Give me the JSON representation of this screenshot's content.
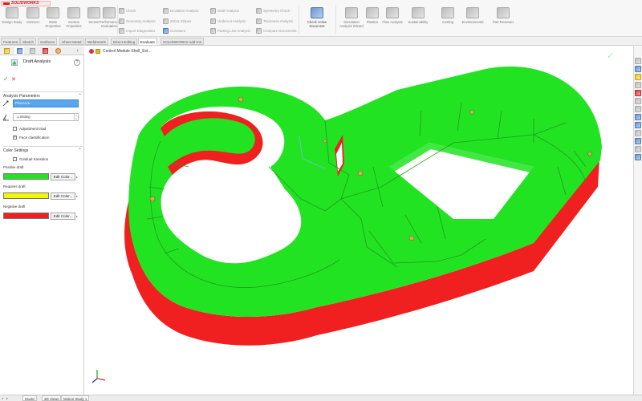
{
  "app": {
    "logo_text": "SOLIDWORKS"
  },
  "ribbon": {
    "big_buttons": [
      {
        "label": "Design Study",
        "icon": "design-study-icon",
        "color": "grey"
      },
      {
        "label": "Reference Compare",
        "icon": "compare-icon",
        "color": "grey"
      },
      {
        "label": "Check Active Document",
        "icon": "check-document-icon",
        "color": "blue"
      },
      {
        "label": "Measure",
        "icon": "measure-icon",
        "color": "grey"
      }
    ],
    "medium_buttons": [
      {
        "label": "Intersect",
        "icon": "intersect-icon",
        "color": "grey"
      },
      {
        "label": "Mass Properties",
        "icon": "mass-properties-icon",
        "color": "grey"
      },
      {
        "label": "Section Properties",
        "icon": "section-properties-icon",
        "color": "grey"
      },
      {
        "label": "Sensor",
        "icon": "sensor-icon",
        "color": "grey"
      },
      {
        "label": "Performance Evaluation",
        "icon": "performance-icon",
        "color": "grey"
      }
    ],
    "small_buttons": [
      {
        "label": "Check",
        "icon": "check-icon",
        "color": "grey"
      },
      {
        "label": "Geometry Analysis",
        "icon": "geometry-analysis-icon",
        "color": "grey"
      },
      {
        "label": "Import Diagnostics",
        "icon": "import-diagnostics-icon",
        "color": "grey"
      },
      {
        "label": "Deviation Analysis",
        "icon": "deviation-icon",
        "color": "grey"
      },
      {
        "label": "Zebra Stripes",
        "icon": "zebra-icon",
        "color": "grey"
      },
      {
        "label": "Curvature",
        "icon": "curvature-icon",
        "color": "blue"
      },
      {
        "label": "Draft Analysis",
        "icon": "draft-analysis-icon",
        "color": "grey"
      },
      {
        "label": "Undercut Analysis",
        "icon": "undercut-icon",
        "color": "grey"
      },
      {
        "label": "Parting Line Analysis",
        "icon": "parting-line-icon",
        "color": "grey"
      },
      {
        "label": "Symmetry Check",
        "icon": "symmetry-icon",
        "color": "grey"
      },
      {
        "label": "Thickness Analysis",
        "icon": "thickness-icon",
        "color": "grey"
      },
      {
        "label": "Compare Documents",
        "icon": "compare-documents-icon",
        "color": "grey"
      }
    ],
    "right_buttons": [
      {
        "label": "Simulation Analysis Wizard",
        "icon": "simulation-icon",
        "color": "grey"
      },
      {
        "label": "Plastics",
        "icon": "plastics-icon",
        "color": "grey"
      },
      {
        "label": "Flow Analysis",
        "icon": "flow-icon",
        "color": "grey"
      },
      {
        "label": "Sustainability",
        "icon": "sustainability-icon",
        "color": "grey"
      },
      {
        "label": "Costing",
        "icon": "costing-icon",
        "color": "grey"
      },
      {
        "label": "Environmental",
        "icon": "environmental-icon",
        "color": "grey"
      },
      {
        "label": "Part Reviewer",
        "icon": "part-reviewer-icon",
        "color": "grey"
      }
    ]
  },
  "command_tabs": [
    {
      "label": "Features",
      "active": false
    },
    {
      "label": "Sketch",
      "active": false
    },
    {
      "label": "Surfaces",
      "active": false
    },
    {
      "label": "Sheet Metal",
      "active": false
    },
    {
      "label": "Weldments",
      "active": false
    },
    {
      "label": "Direct Editing",
      "active": false
    },
    {
      "label": "Evaluate",
      "active": true
    },
    {
      "label": "SOLIDWORKS Add-Ins",
      "active": false
    }
  ],
  "property_manager": {
    "tabs": [
      {
        "icon": "feature-manager-icon",
        "color": "yellow"
      },
      {
        "icon": "property-manager-icon",
        "color": "blue"
      },
      {
        "icon": "configuration-manager-icon",
        "color": "grey"
      },
      {
        "icon": "dimxpert-icon",
        "color": "red"
      },
      {
        "icon": "display-manager-icon",
        "color": "orange"
      }
    ],
    "collapse_glyph": "›",
    "title": "Draft Analysis",
    "help_glyph": "?",
    "ok_glyph": "✓",
    "cancel_glyph": "✕",
    "analysis_parameters": {
      "heading": "Analysis Parameters",
      "chevron": "⌃",
      "face_selection": "Plane1/a",
      "draft_angle": "1.00deg",
      "adjustment_triad_label": "Adjustment triad",
      "adjustment_triad": false,
      "face_classification_label": "Face classification",
      "face_classification": true
    },
    "color_settings": {
      "heading": "Color Settings",
      "chevron": "⌃",
      "gradual_transition_label": "Gradual transition",
      "gradual_transition": false,
      "positive_label": "Positive draft",
      "positive_color": "#22e322",
      "required_label": "Requires draft",
      "required_color": "#f5f505",
      "negative_label": "Negative draft",
      "negative_color": "#f02020",
      "edit_button_label": "Edit Color...",
      "edit_arrow": "▸"
    }
  },
  "graphics": {
    "breadcrumb": "Control Module Shell_Ext...",
    "ok_glyph": "✓",
    "cancel_glyph": "✕",
    "model_colors": {
      "positive": "#22e322",
      "negative": "#f02020",
      "rib_edge": "#1a9e1a",
      "boss_hole": "#c8b54a"
    },
    "triad_axes": [
      "x",
      "y",
      "z"
    ]
  },
  "task_pane": [
    {
      "icon": "resources-icon",
      "color": "grey"
    },
    {
      "icon": "design-library-icon",
      "color": "blue"
    },
    {
      "icon": "file-explorer-icon",
      "color": "yellow"
    },
    {
      "icon": "view-palette-icon",
      "color": "grey"
    },
    {
      "icon": "appearances-icon",
      "color": "red"
    },
    {
      "icon": "custom-properties-icon",
      "color": "grey"
    },
    {
      "icon": "solidworks-forum-icon",
      "color": "grey"
    },
    {
      "icon": "toolbox-icon",
      "color": "blue"
    },
    {
      "icon": "3dexperience-icon",
      "color": "blue"
    },
    {
      "icon": "markup-icon",
      "color": "grey"
    },
    {
      "icon": "cloud-icon",
      "color": "blue"
    },
    {
      "icon": "settings-icon",
      "color": "grey"
    },
    {
      "icon": "help-icon",
      "color": "blue"
    }
  ],
  "bottom_tabs": {
    "nav_glyphs": [
      "◂",
      "▸"
    ],
    "tabs": [
      {
        "label": "Model",
        "active": true
      },
      {
        "label": "3D Views",
        "active": false
      },
      {
        "label": "Motion Study 1",
        "active": false
      }
    ]
  }
}
